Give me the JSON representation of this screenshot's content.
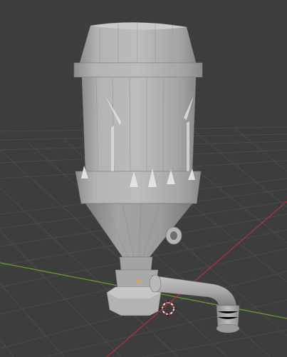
{
  "viewport": {
    "background": "#3d3d3d",
    "grid_color": "#4a4a4a",
    "x_axis_color": "#a8323f",
    "y_axis_color": "#6a9a2a",
    "model_color": "#a6a6a6",
    "origin_color": "#f2a03a",
    "cursor_color": "#c93b3b"
  },
  "scene": {
    "object": "silo-hopper-model",
    "view": "3d-viewport",
    "icons": [
      "3d-cursor-icon",
      "object-origin-icon"
    ]
  }
}
